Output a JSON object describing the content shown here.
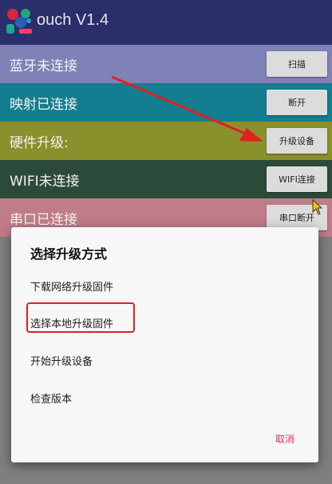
{
  "app": {
    "title": "ouch V1.4"
  },
  "rows": [
    {
      "label": "蓝牙未连接",
      "button": "扫描",
      "color": "#7f82b6"
    },
    {
      "label": "映射已连接",
      "button": "断开",
      "color": "#137e8f"
    },
    {
      "label": "硬件升级:",
      "button": "升级设备",
      "color": "#8a902c"
    },
    {
      "label": "WIFI未连接",
      "button": "WIFI连接",
      "color": "#2c4a39"
    },
    {
      "label": "串口已连接",
      "button": "串口断开",
      "color": "#c07c88"
    }
  ],
  "dialog": {
    "title": "选择升级方式",
    "items": [
      "下载网络升级固件",
      "选择本地升级固件",
      "开始升级设备",
      "检查版本"
    ],
    "cancel": "取消"
  },
  "colors": {
    "accent": "#e0306a",
    "annotation_red": "#e02020",
    "appbar": "#2a2e6b"
  }
}
